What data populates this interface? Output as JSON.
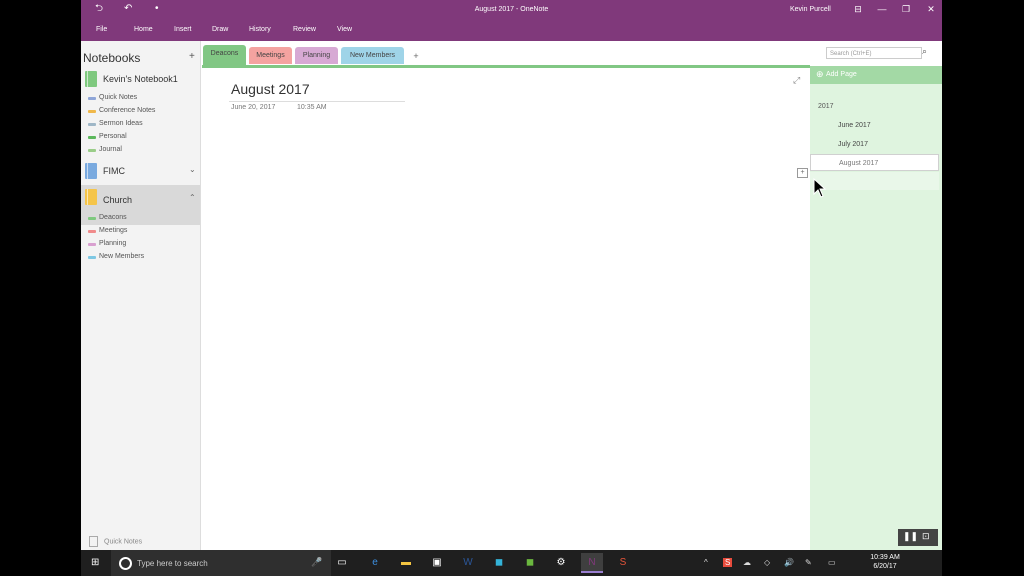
{
  "window": {
    "document_title": "August 2017  -  OneNote",
    "user": "Kevin Purcell",
    "back_glyph": "⮌",
    "undo_glyph": "↶",
    "dot_glyph": "•"
  },
  "ribbon": {
    "tabs": [
      "File",
      "Home",
      "Insert",
      "Draw",
      "History",
      "Review",
      "View"
    ]
  },
  "notebooks_pane": {
    "heading": "Notebooks",
    "add_glyph": "+",
    "notebooks": [
      {
        "name": "Kevin's Notebook1",
        "color": "#7fc97f",
        "chevron": "⌃",
        "sections": [
          {
            "label": "Quick Notes",
            "color": "#8fa6d8"
          },
          {
            "label": "Conference Notes",
            "color": "#f0b84a"
          },
          {
            "label": "Sermon Ideas",
            "color": "#9fb7c7"
          },
          {
            "label": "Personal",
            "color": "#5cb85c"
          },
          {
            "label": "Journal",
            "color": "#9acd88"
          }
        ]
      },
      {
        "name": "FIMC",
        "color": "#7aaadf",
        "chevron": "⌄",
        "sections": []
      },
      {
        "name": "Church",
        "color": "#f5c54a",
        "chevron": "⌃",
        "sections": [
          {
            "label": "Deacons",
            "color": "#7fc97f"
          },
          {
            "label": "Meetings",
            "color": "#f08b8b"
          },
          {
            "label": "Planning",
            "color": "#d9a0d0"
          },
          {
            "label": "New Members",
            "color": "#7ec8e3"
          }
        ]
      }
    ],
    "quick_notes": "Quick Notes"
  },
  "section_tabs": [
    {
      "label": "Deacons",
      "color": "#81c784"
    },
    {
      "label": "Meetings",
      "color": "#f4a3a0"
    },
    {
      "label": "Planning",
      "color": "#d7a9d4"
    },
    {
      "label": "New Members",
      "color": "#9fd4e8"
    }
  ],
  "add_tab_glyph": "+",
  "search": {
    "placeholder": "Search (Ctrl+E)",
    "icon_glyph": "⌕"
  },
  "page": {
    "title": "August 2017",
    "date": "June 20, 2017",
    "time": "10:35 AM",
    "expand_glyph": "⤢"
  },
  "pages_pane": {
    "add_page": "Add Page",
    "add_glyph": "⊕",
    "year": "2017",
    "items": [
      {
        "label": "June 2017",
        "selected": false
      },
      {
        "label": "July 2017",
        "selected": false
      },
      {
        "label": "August 2017",
        "selected": true
      }
    ],
    "insert_glyph": "+"
  },
  "taskbar": {
    "start_glyph": "⊞",
    "search_placeholder": "Type here to search",
    "mic_glyph": "🎤",
    "apps": [
      {
        "name": "task-view",
        "glyph": "▭",
        "color": "#ffffff"
      },
      {
        "name": "edge",
        "glyph": "e",
        "color": "#3c8fe0"
      },
      {
        "name": "file-explorer",
        "glyph": "▬",
        "color": "#f4c542"
      },
      {
        "name": "store",
        "glyph": "▣",
        "color": "#ffffff"
      },
      {
        "name": "word",
        "glyph": "W",
        "color": "#2b579a"
      },
      {
        "name": "app-cyan",
        "glyph": "◼",
        "color": "#34b3d8"
      },
      {
        "name": "app-green",
        "glyph": "◼",
        "color": "#6bb83f"
      },
      {
        "name": "settings",
        "glyph": "⚙",
        "color": "#ffffff"
      },
      {
        "name": "onenote",
        "glyph": "N",
        "color": "#80397b"
      },
      {
        "name": "snagit",
        "glyph": "S",
        "color": "#e8553a"
      }
    ],
    "tray": [
      "^",
      "S",
      "☁",
      "◇",
      "🔊",
      "✎",
      "▭"
    ],
    "clock_time": "10:39 AM",
    "clock_date": "6/20/17"
  },
  "playback": {
    "pause_glyph": "❚❚",
    "person_glyph": "⊡"
  }
}
